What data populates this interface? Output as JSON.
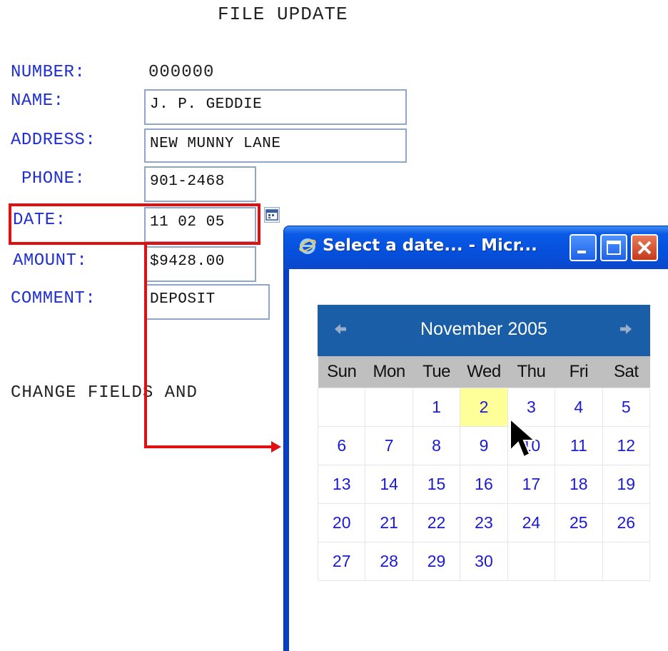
{
  "form": {
    "title": "FILE UPDATE",
    "number_label": "NUMBER:",
    "number_value": "000000",
    "name_label": "NAME:",
    "name_value": "J. P. GEDDIE",
    "address_label": "ADDRESS:",
    "address_value": "NEW MUNNY LANE",
    "phone_label": "PHONE:",
    "phone_value": "901-2468",
    "date_label": "DATE:",
    "date_value": "11 02 05",
    "amount_label": "AMOUNT:",
    "amount_value": "$9428.00",
    "comment_label": "COMMENT:",
    "comment_value": "DEPOSIT",
    "instruction_text": "CHANGE FIELDS AND"
  },
  "popup": {
    "title": "Select a date... - Micr...",
    "icon": "ie-icon",
    "buttons": [
      "minimize-icon",
      "maximize-icon",
      "close-icon"
    ]
  },
  "calendar": {
    "month_title": "November 2005",
    "prev_icon": "arrow-left-icon",
    "next_icon": "arrow-right-icon",
    "weekdays": [
      "Sun",
      "Mon",
      "Tue",
      "Wed",
      "Thu",
      "Fri",
      "Sat"
    ],
    "weeks": [
      [
        "",
        "",
        "1",
        "2",
        "3",
        "4",
        "5"
      ],
      [
        "6",
        "7",
        "8",
        "9",
        "10",
        "11",
        "12"
      ],
      [
        "13",
        "14",
        "15",
        "16",
        "17",
        "18",
        "19"
      ],
      [
        "20",
        "21",
        "22",
        "23",
        "24",
        "25",
        "26"
      ],
      [
        "27",
        "28",
        "29",
        "30",
        "",
        "",
        ""
      ]
    ],
    "selected_day": "2",
    "header_color": "#1a5ea8",
    "selected_color": "#ffff99",
    "day_color": "#1a1ad0"
  },
  "colors": {
    "label": "#1f2fd0",
    "highlight": "#e01010",
    "field_border": "#8fa6c8"
  }
}
